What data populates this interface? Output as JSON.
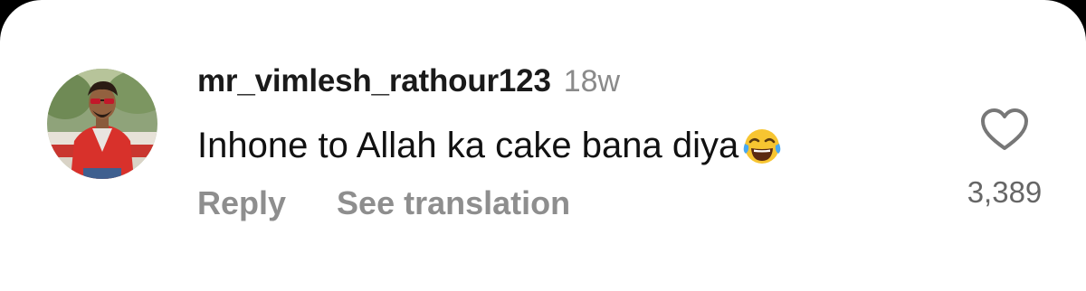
{
  "comment": {
    "username": "mr_vimlesh_rathour123",
    "timestamp": "18w",
    "text": "Inhone to Allah ka cake bana diya",
    "emoji": "face-with-tears-of-joy-icon",
    "actions": {
      "reply": "Reply",
      "see_translation": "See translation"
    },
    "likes": "3,389",
    "like_icon": "heart-outline-icon"
  },
  "colors": {
    "background": "#ffffff",
    "username": "#1a1a1a",
    "timestamp": "#8a8a8a",
    "text": "#111111",
    "action": "#8e8e8e",
    "like_count": "#666666"
  }
}
